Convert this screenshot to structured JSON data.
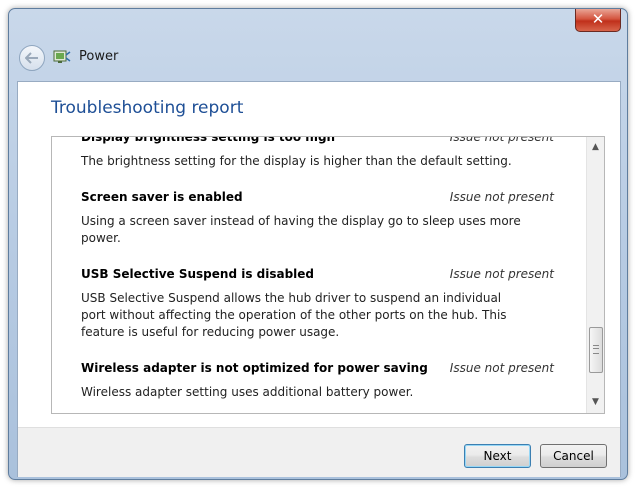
{
  "window": {
    "title": "Power",
    "close_glyph": "✕"
  },
  "page": {
    "title": "Troubleshooting report"
  },
  "report": {
    "items": [
      {
        "title": "Display brightness setting is too high",
        "status": "Issue not present",
        "description": "The brightness setting for the display is higher than the default setting."
      },
      {
        "title": "Screen saver is enabled",
        "status": "Issue not present",
        "description": "Using a screen saver instead of having the display go to sleep uses more power."
      },
      {
        "title": "USB Selective Suspend is disabled",
        "status": "Issue not present",
        "description": "USB Selective Suspend allows the hub driver to suspend an individual port without affecting the operation of the other ports on the hub. This feature is useful for reducing power usage."
      },
      {
        "title": "Wireless adapter is not optimized for power saving",
        "status": "Issue not present",
        "description": "Wireless adapter setting uses additional battery power."
      }
    ]
  },
  "buttons": {
    "next": "Next",
    "cancel": "Cancel"
  },
  "icons": {
    "back": "back-arrow-icon",
    "app": "power-options-icon",
    "close": "close-icon"
  },
  "colors": {
    "title_blue": "#1e4f96",
    "close_red": "#c0301b"
  }
}
